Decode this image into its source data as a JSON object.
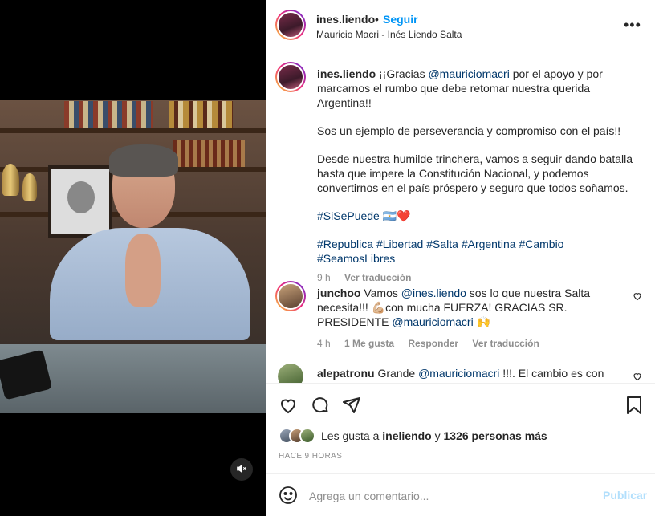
{
  "header": {
    "username": "ines.liendo",
    "separator": "•",
    "follow_label": "Seguir",
    "subtitle": "Mauricio Macri - Inés Liendo Salta",
    "more_label": "•••"
  },
  "caption": {
    "username": "ines.liendo",
    "intro_prefix": "¡¡Gracias ",
    "mention": "@mauriciomacri",
    "intro_suffix": " por el apoyo y por marcarnos el rumbo que debe retomar nuestra querida Argentina!!",
    "line2": "Sos un ejemplo de perseverancia y compromiso con el país!!",
    "line3": "Desde nuestra humilde trinchera, vamos a seguir dando batalla hasta que impere la Constitución Nacional, y podemos convertirnos en el país próspero y seguro que todos soñamos.",
    "hashtag_main": "#SiSePuede",
    "emojis": "🇦🇷❤️",
    "hashtags": [
      "#Republica",
      "#Libertad",
      "#Salta",
      "#Argentina",
      "#Cambio",
      "#SeamosLibres"
    ],
    "time": "9 h",
    "translate": "Ver traducción"
  },
  "comments": [
    {
      "username": "junchoo",
      "text_prefix": "Vamos ",
      "mention1": "@ines.liendo",
      "text_middle": " sos lo que nuestra Salta necesita!!! 💪🏼con mucha FUERZA! GRACIAS SR. PRESIDENTE ",
      "mention2": "@mauriciomacri",
      "text_suffix": " 🙌",
      "time": "4 h",
      "likes": "1 Me gusta",
      "reply": "Responder",
      "translate": "Ver traducción"
    },
    {
      "username": "alepatronu",
      "text_prefix": "Grande ",
      "mention1": "@mauriciomacri",
      "text_suffix": " !!!. El cambio es con Inés"
    }
  ],
  "likes": {
    "prefix": "Les gusta a ",
    "user": "ineliendo",
    "middle": " y ",
    "count": "1326 personas más"
  },
  "timestamp": "HACE 9 HORAS",
  "composer": {
    "placeholder": "Agrega un comentario...",
    "publish_label": "Publicar"
  },
  "colors": {
    "link": "#00376b",
    "follow": "#0095f6",
    "publish_disabled": "#b2dffc",
    "muted": "#8e8e8e"
  },
  "icons": [
    "mute-icon",
    "more-icon",
    "heart-icon",
    "comment-icon",
    "share-icon",
    "bookmark-icon",
    "emoji-icon"
  ]
}
